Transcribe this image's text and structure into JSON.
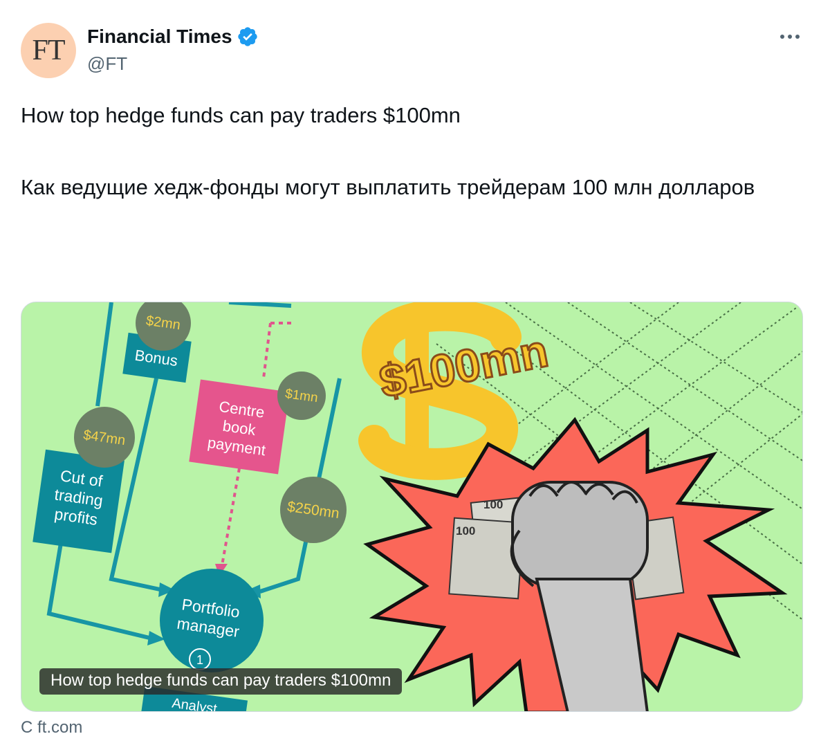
{
  "account": {
    "avatar_text": "FT",
    "name": "Financial Times",
    "handle": "@FT",
    "verified": true,
    "brand_color": "#fcd0b1",
    "verified_color": "#1d9bf0"
  },
  "menu": {
    "icon": "more-dots-icon"
  },
  "tweet": {
    "text_en": "How top hedge funds can pay traders $100mn",
    "text_ru": "Как ведущие хедж-фонды могут выплатить трейдерам 100 млн долларов"
  },
  "card": {
    "caption": "How top hedge funds can pay traders $100mn",
    "source": "С ft.com",
    "image": {
      "background": "#b9f3a8",
      "amounts": {
        "bonus_amount": "$2mn",
        "cut_amount": "$47mn",
        "centre_amount": "$1mn",
        "big_amount": "$250mn",
        "headline": "$100mn"
      },
      "boxes": {
        "bonus": "Bonus",
        "cut_line1": "Cut of",
        "cut_line2": "trading",
        "cut_line3": "profits",
        "centre_line1": "Centre",
        "centre_line2": "book",
        "centre_line3": "payment",
        "pm_line1": "Portfolio",
        "pm_line2": "manager",
        "pm_number": "1",
        "analyst": "Analyst"
      },
      "bill_label": "100"
    }
  }
}
